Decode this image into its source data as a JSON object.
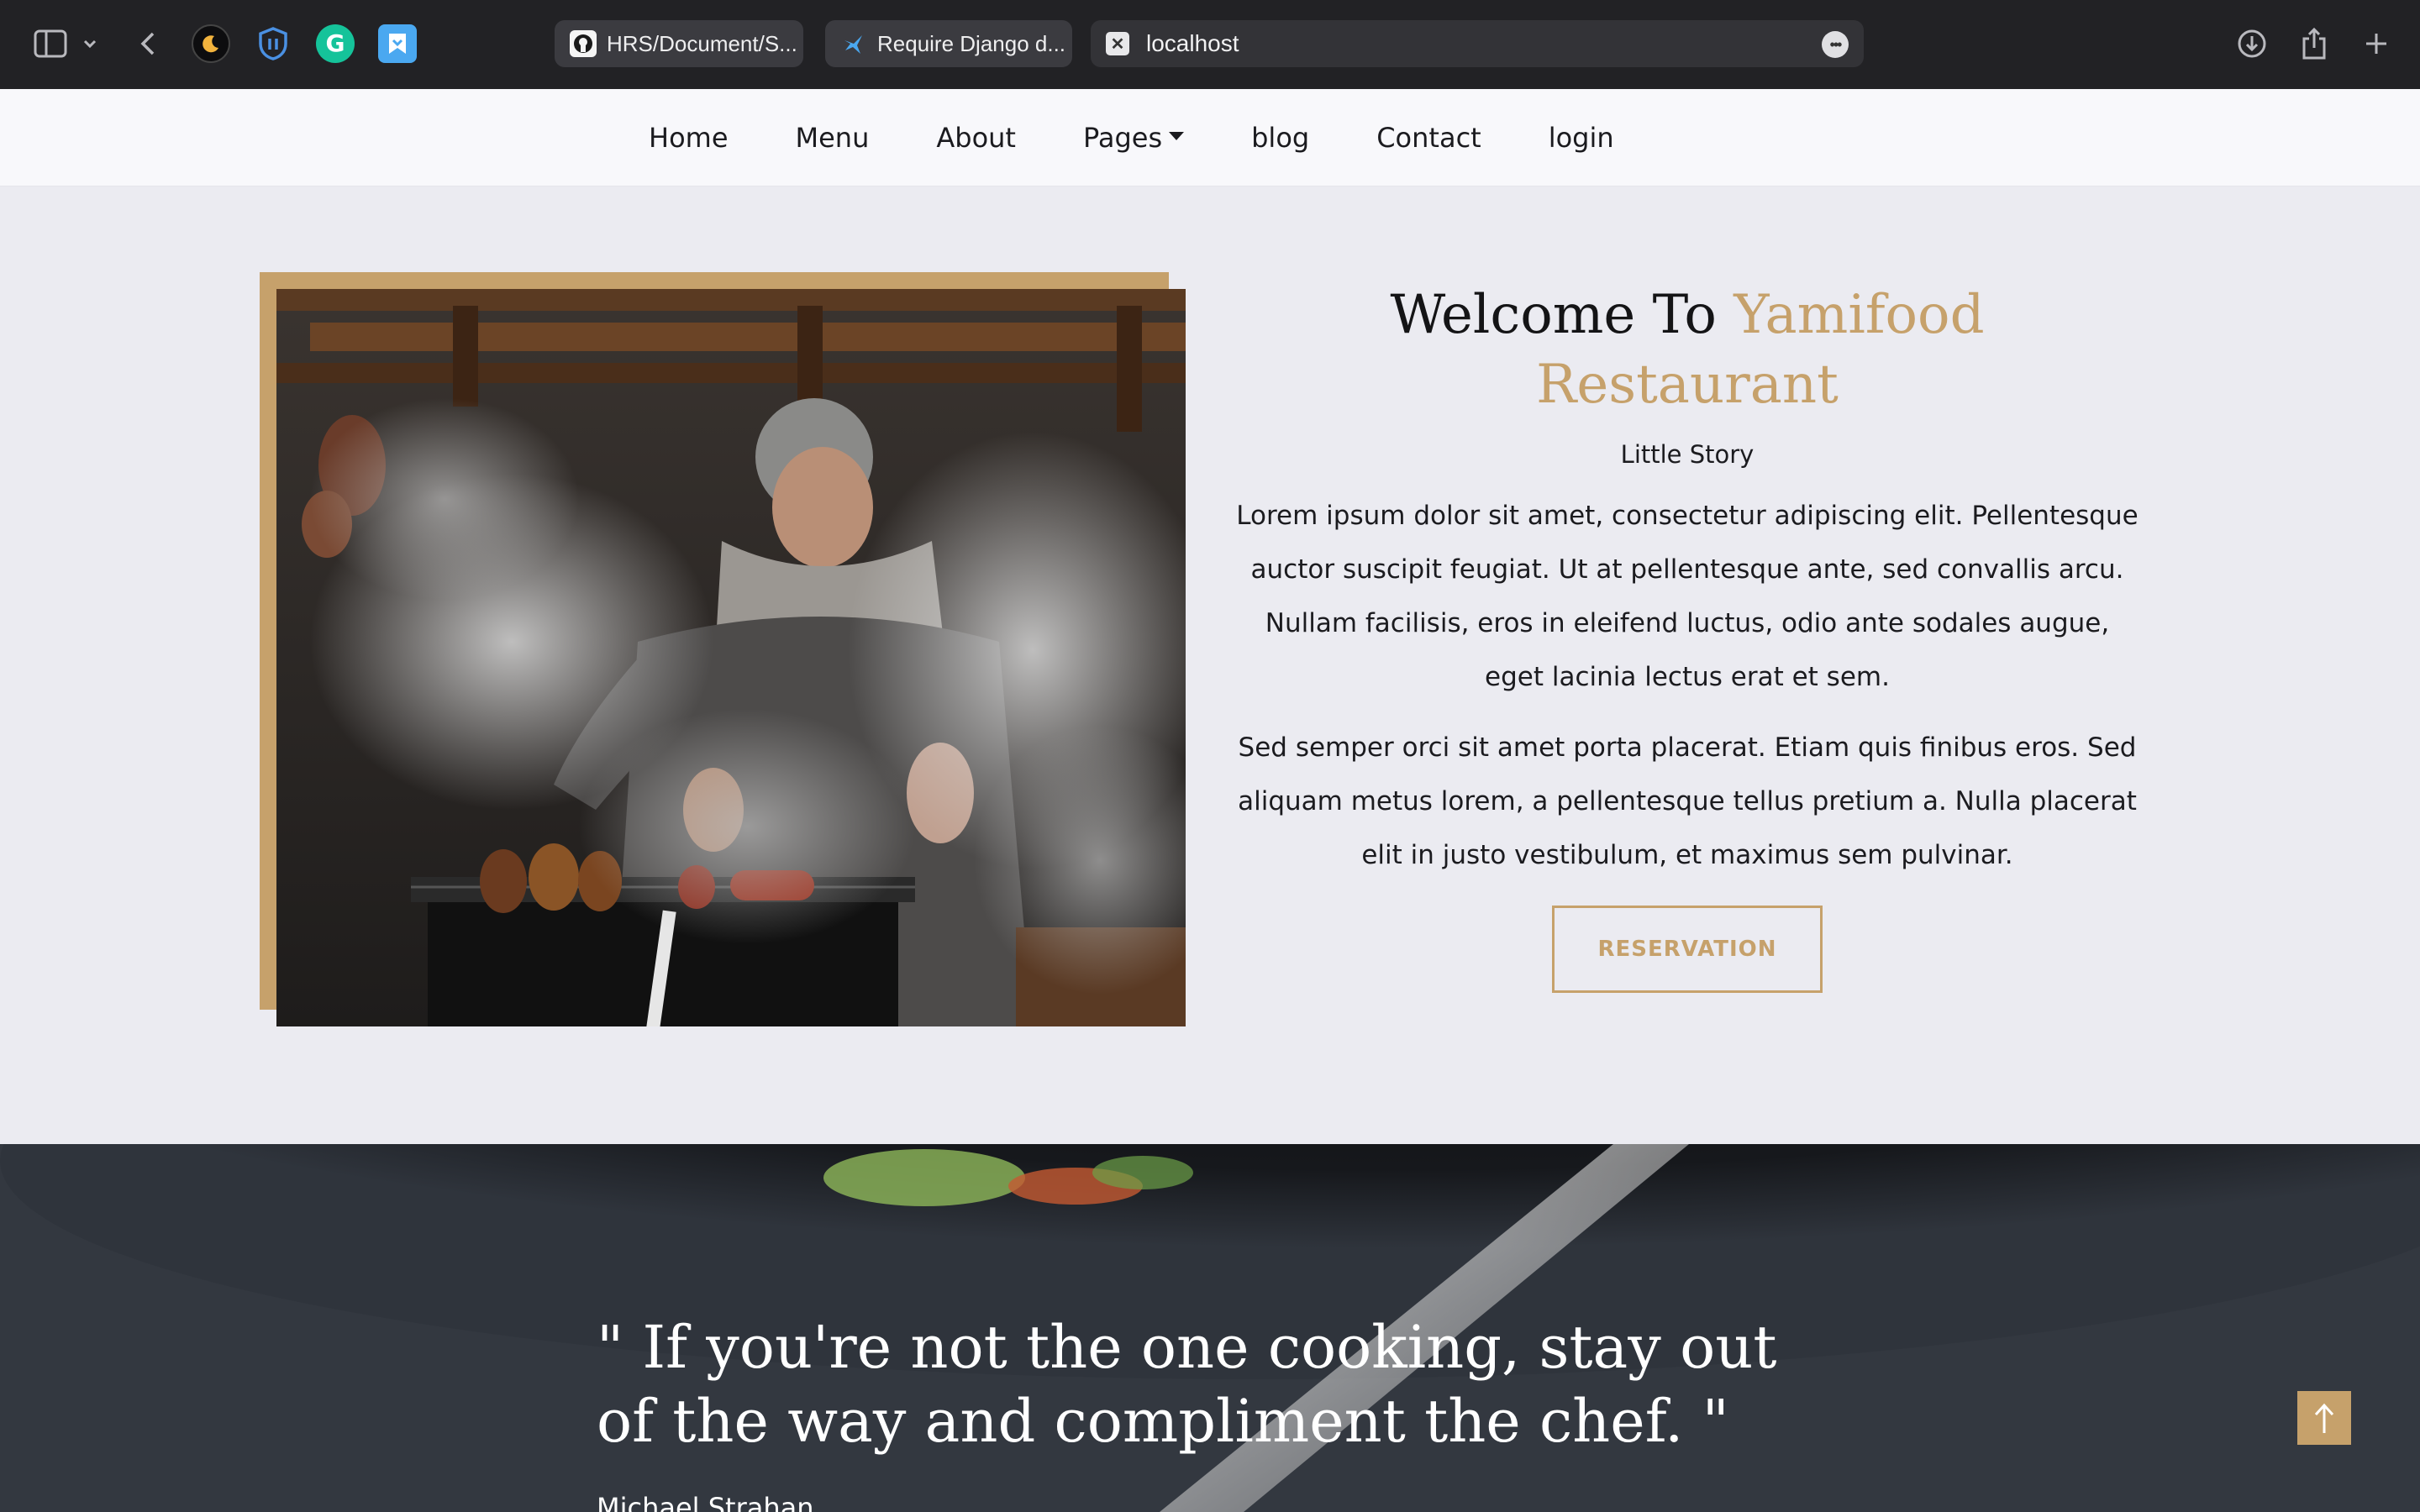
{
  "browser": {
    "tabs": [
      {
        "label": "HRS/Document/S...",
        "icon": "github-icon"
      },
      {
        "label": "Require Django d...",
        "icon": "bird-icon"
      }
    ],
    "url": "localhost",
    "extensions": [
      "dark-mode-icon",
      "shield-icon",
      "grammarly-icon",
      "bookmark-icon"
    ]
  },
  "nav": {
    "items": [
      "Home",
      "Menu",
      "About",
      "Pages",
      "blog",
      "Contact",
      "login"
    ]
  },
  "about": {
    "title_prefix": "Welcome To",
    "title_accent": "Yamifood Restaurant",
    "subtitle": "Little Story",
    "paragraph1": "Lorem ipsum dolor sit amet, consectetur adipiscing elit. Pellentesque auctor suscipit feugiat. Ut at pellentesque ante, sed convallis arcu. Nullam facilisis, eros in eleifend luctus, odio ante sodales augue, eget lacinia lectus erat et sem.",
    "paragraph2": "Sed semper orci sit amet porta placerat. Etiam quis finibus eros. Sed aliquam metus lorem, a pellentesque tellus pretium a. Nulla placerat elit in justo vestibulum, et maximus sem pulvinar.",
    "button": "RESERVATION"
  },
  "quote": {
    "text": "\" If you're not the one cooking, stay out of the way and compliment the chef. \"",
    "author": "Michael Strahan"
  },
  "colors": {
    "accent": "#c6a16b",
    "chrome": "#222225",
    "page_bg": "#ebebf1"
  }
}
